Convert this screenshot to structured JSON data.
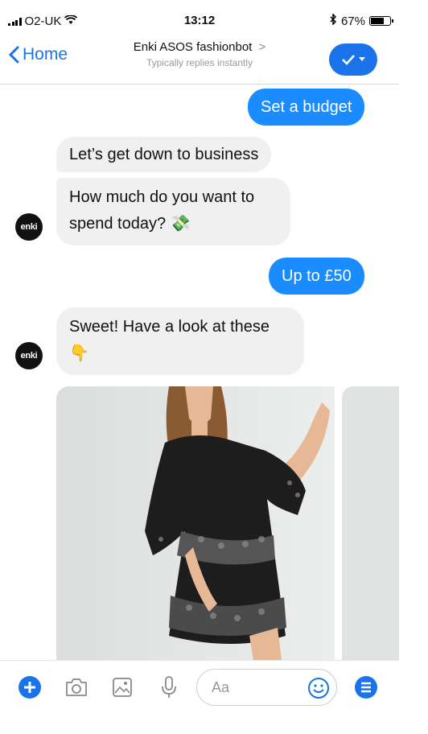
{
  "status_bar": {
    "carrier": "O2-UK",
    "time": "13:12",
    "battery": "67%"
  },
  "header": {
    "back_label": "Home",
    "title": "Enki ASOS fashionbot",
    "title_chevron": ">",
    "subtitle": "Typically replies instantly"
  },
  "messages": [
    {
      "from": "user",
      "text": "Set a budget"
    },
    {
      "from": "bot",
      "text": "Let’s get down to business"
    },
    {
      "from": "bot",
      "line1": "How much do you want to",
      "line2": "spend today?",
      "emoji": "💸"
    },
    {
      "from": "user",
      "text": "Up to £50"
    },
    {
      "from": "bot",
      "line1": "Sweet! Have a look at these",
      "emoji": "👇"
    }
  ],
  "bot": {
    "avatar_label": "enki"
  },
  "composer": {
    "placeholder": "Aa"
  },
  "colors": {
    "accent": "#1a73e8",
    "outgoing_bubble": "#1a8cff",
    "incoming_bubble": "#f1f0f0"
  }
}
